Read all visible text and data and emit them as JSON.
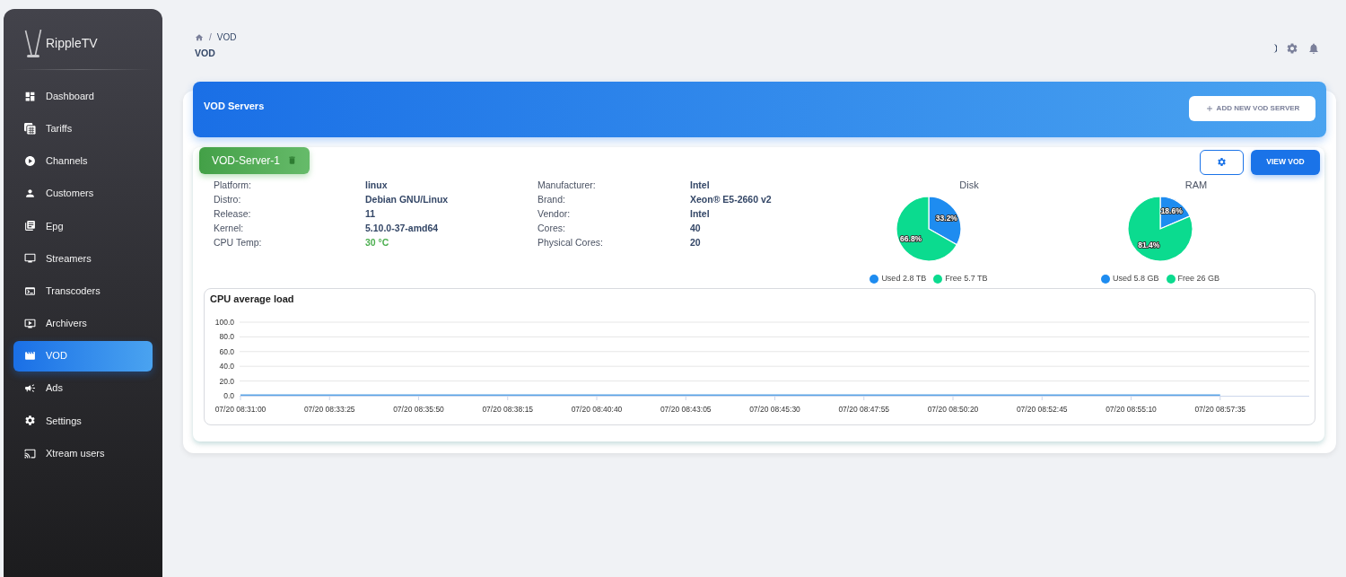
{
  "sidebar": {
    "brand": "RippleTV",
    "items": [
      {
        "label": "Dashboard",
        "selected": false
      },
      {
        "label": "Tariffs",
        "selected": false
      },
      {
        "label": "Channels",
        "selected": false
      },
      {
        "label": "Customers",
        "selected": false
      },
      {
        "label": "Epg",
        "selected": false
      },
      {
        "label": "Streamers",
        "selected": false
      },
      {
        "label": "Transcoders",
        "selected": false
      },
      {
        "label": "Archivers",
        "selected": false
      },
      {
        "label": "VOD",
        "selected": true
      },
      {
        "label": "Ads",
        "selected": false
      },
      {
        "label": "Settings",
        "selected": false
      },
      {
        "label": "Xtream users",
        "selected": false
      }
    ]
  },
  "breadcrumb": {
    "separator": "/",
    "current": "VOD"
  },
  "page_title": "VOD",
  "servers_panel": {
    "title": "VOD Servers",
    "add_button": "ADD NEW VOD SERVER",
    "servers": [
      {
        "name": "VOD-Server-1",
        "view_button": "VIEW VOD",
        "specs_left": [
          {
            "label": "Platform:",
            "value": "linux",
            "kind": "plain"
          },
          {
            "label": "Distro:",
            "value": "Debian GNU/Linux",
            "kind": "plain"
          },
          {
            "label": "Release:",
            "value": "11",
            "kind": "plain"
          },
          {
            "label": "Kernel:",
            "value": "5.10.0-37-amd64",
            "kind": "plain"
          },
          {
            "label": "CPU Temp:",
            "value": "30 °C",
            "kind": "temperature"
          }
        ],
        "specs_right": [
          {
            "label": "Manufacturer:",
            "value": "Intel",
            "kind": "plain"
          },
          {
            "label": "Brand:",
            "value": "Xeon® E5-2660 v2",
            "kind": "plain"
          },
          {
            "label": "Vendor:",
            "value": "Intel",
            "kind": "plain"
          },
          {
            "label": "Cores:",
            "value": "40",
            "kind": "plain"
          },
          {
            "label": "Physical Cores:",
            "value": "20",
            "kind": "plain"
          }
        ],
        "disk": {
          "chart_data": {
            "type": "pie",
            "title": "Disk",
            "categories": [
              "Used 2.8 TB",
              "Free 5.7 TB"
            ],
            "values": [
              33.2,
              66.8
            ],
            "colors": [
              "#1e8cf0",
              "#0bdb8f"
            ],
            "value_labels": [
              "33.2%",
              "66.8%"
            ],
            "legend": "bottom"
          }
        },
        "ram": {
          "chart_data": {
            "type": "pie",
            "title": "RAM",
            "categories": [
              "Used 5.8 GB",
              "Free 26 GB"
            ],
            "values": [
              18.6,
              81.4
            ],
            "colors": [
              "#1e8cf0",
              "#0bdb8f"
            ],
            "value_labels": [
              "18.6%",
              "81.4%"
            ],
            "legend": "bottom"
          }
        },
        "cpu_chart": {
          "chart_data": {
            "type": "line",
            "title": "CPU average load",
            "categories": [
              "07/20 08:31:00",
              "07/20 08:33:25",
              "07/20 08:35:50",
              "07/20 08:38:15",
              "07/20 08:40:40",
              "07/20 08:43:05",
              "07/20 08:45:30",
              "07/20 08:47:55",
              "07/20 08:50:20",
              "07/20 08:52:45",
              "07/20 08:55:10",
              "07/20 08:57:35"
            ],
            "values": [
              1,
              1,
              1,
              1,
              1,
              1,
              1,
              1,
              1,
              1,
              1,
              1
            ],
            "ylim": [
              0,
              100
            ],
            "yticks": [
              {
                "value": 0,
                "label": "0.0"
              },
              {
                "value": 20,
                "label": "20.0"
              },
              {
                "value": 40,
                "label": "40.0"
              },
              {
                "value": 60,
                "label": "60.0"
              },
              {
                "value": 80,
                "label": "80.0"
              },
              {
                "value": 100,
                "label": "100.0"
              }
            ],
            "grid": true
          }
        }
      }
    ]
  }
}
